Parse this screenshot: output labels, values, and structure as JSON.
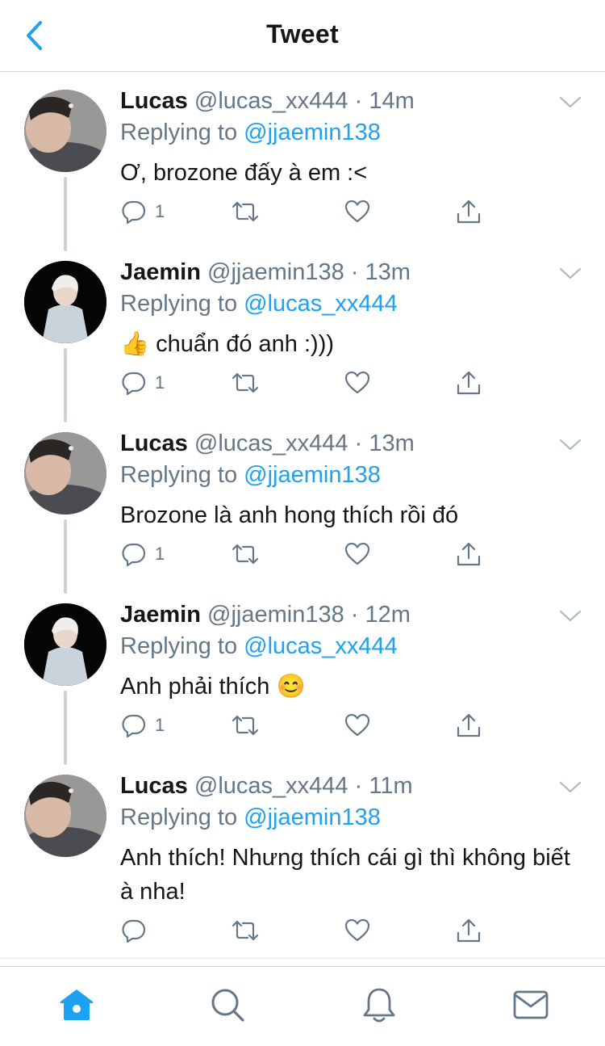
{
  "header": {
    "title": "Tweet",
    "back_icon": "chevron-left-icon",
    "accent": "#1da1f2"
  },
  "colors": {
    "accent": "#1da1f2",
    "secondary_text": "#657786",
    "primary_text": "#14171a"
  },
  "tweets": [
    {
      "name": "Lucas",
      "handle": "@lucas_xx444",
      "time": "14m",
      "replying_label": "Replying to",
      "replying_to": "@jjaemin138",
      "text": "Ơ, brozone đấy à em :<",
      "reply_count": "1"
    },
    {
      "name": "Jaemin",
      "handle": "@jjaemin138",
      "time": "13m",
      "replying_label": "Replying to",
      "replying_to": "@lucas_xx444",
      "text": "👍 chuẩn đó anh :)))",
      "reply_count": "1"
    },
    {
      "name": "Lucas",
      "handle": "@lucas_xx444",
      "time": "13m",
      "replying_label": "Replying to",
      "replying_to": "@jjaemin138",
      "text": "Brozone là anh hong thích rồi đó",
      "reply_count": "1"
    },
    {
      "name": "Jaemin",
      "handle": "@jjaemin138",
      "time": "12m",
      "replying_label": "Replying to",
      "replying_to": "@lucas_xx444",
      "text": "Anh phải thích 😊",
      "reply_count": "1"
    },
    {
      "name": "Lucas",
      "handle": "@lucas_xx444",
      "time": "11m",
      "replying_label": "Replying to",
      "replying_to": "@jjaemin138",
      "text": "Anh thích! Nhưng thích cái gì thì không biết à nha!",
      "reply_count": ""
    }
  ],
  "tab_bar": {
    "items": [
      {
        "icon": "home-icon",
        "active": true
      },
      {
        "icon": "search-icon",
        "active": false
      },
      {
        "icon": "bell-icon",
        "active": false
      },
      {
        "icon": "mail-icon",
        "active": false
      }
    ]
  },
  "dot": "·"
}
